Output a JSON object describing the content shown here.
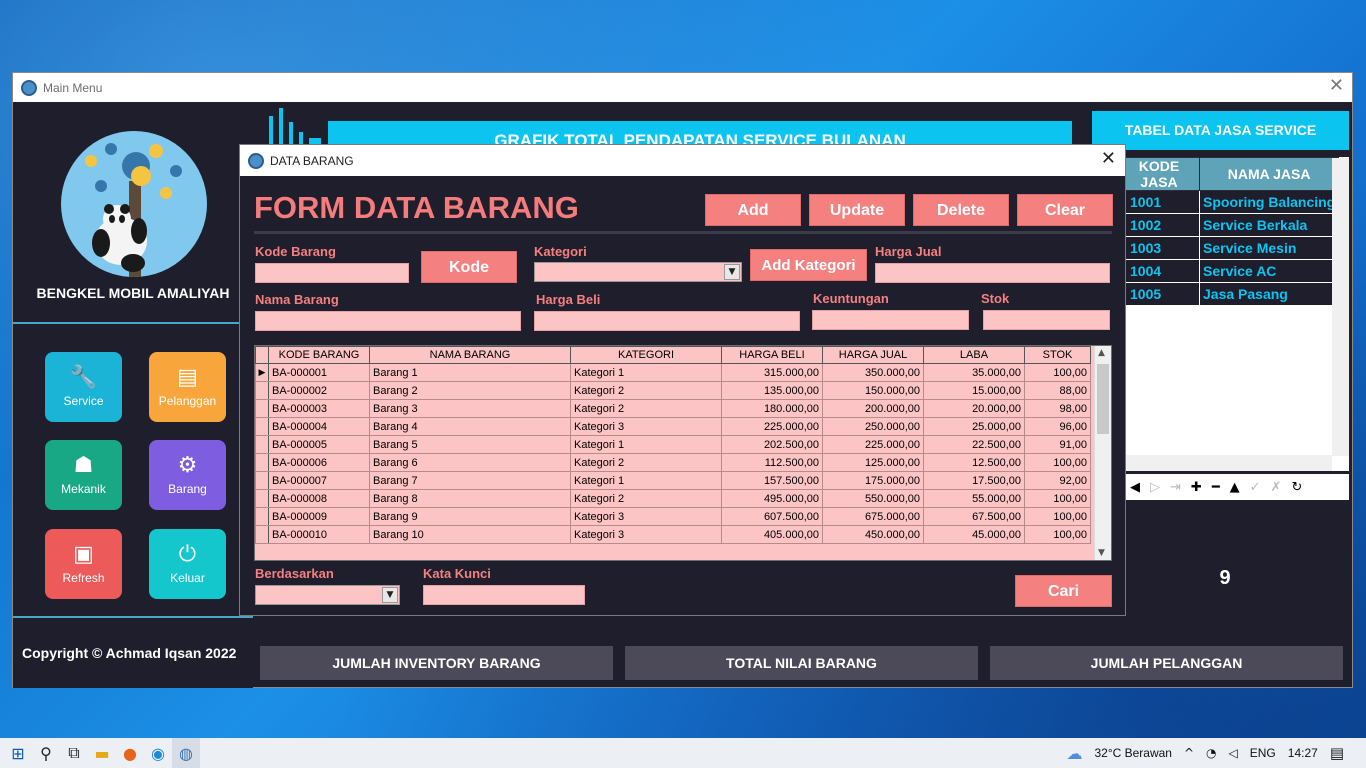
{
  "main_window": {
    "title": "Main Menu",
    "brand": "BENGKEL MOBIL AMALIYAH",
    "copyright": "Copyright © Achmad Iqsan 2022",
    "menu": [
      {
        "label": "Service",
        "icon": "wrench-icon",
        "color": "#1bb3d6"
      },
      {
        "label": "Pelanggan",
        "icon": "id-card-icon",
        "color": "#f8a63c"
      },
      {
        "label": "Mekanik",
        "icon": "mechanic-icon",
        "color": "#18a886"
      },
      {
        "label": "Barang",
        "icon": "gears-icon",
        "color": "#7e5de0"
      },
      {
        "label": "Refresh",
        "icon": "floppy-icon",
        "color": "#ec5a5a"
      },
      {
        "label": "Keluar",
        "icon": "power-icon",
        "color": "#14c7cc"
      }
    ],
    "chart_title": "GRAFIK TOTAL PENDAPATAN SERVICE BULANAN",
    "tabel_jasa_title": "TABEL DATA JASA SERVICE",
    "jasa_table": {
      "headers": [
        "KODE JASA",
        "NAMA JASA"
      ],
      "rows": [
        [
          "1001",
          "Spooring Balancing"
        ],
        [
          "1002",
          "Service Berkala"
        ],
        [
          "1003",
          "Service Mesin"
        ],
        [
          "1004",
          "Service AC"
        ],
        [
          "1005",
          "Jasa Pasang"
        ]
      ]
    },
    "stat_value": "9",
    "stats": [
      "JUMLAH INVENTORY BARANG",
      "TOTAL NILAI BARANG",
      "JUMLAH PELANGGAN"
    ]
  },
  "dialog": {
    "title": "DATA BARANG",
    "form_title": "FORM DATA BARANG",
    "buttons": {
      "add": "Add",
      "update": "Update",
      "delete": "Delete",
      "clear": "Clear",
      "kode": "Kode",
      "add_kategori": "Add Kategori",
      "cari": "Cari"
    },
    "labels": {
      "kode_barang": "Kode Barang",
      "kategori": "Kategori",
      "harga_jual": "Harga Jual",
      "nama_barang": "Nama Barang",
      "harga_beli": "Harga Beli",
      "keuntungan": "Keuntungan",
      "stok": "Stok",
      "berdasarkan": "Berdasarkan",
      "kata_kunci": "Kata Kunci"
    },
    "grid": {
      "headers": [
        "KODE BARANG",
        "NAMA BARANG",
        "KATEGORI",
        "HARGA BELI",
        "HARGA JUAL",
        "LABA",
        "STOK"
      ],
      "rows": [
        [
          "BA-000001",
          "Barang 1",
          "Kategori 1",
          "315.000,00",
          "350.000,00",
          "35.000,00",
          "100,00"
        ],
        [
          "BA-000002",
          "Barang 2",
          "Kategori 2",
          "135.000,00",
          "150.000,00",
          "15.000,00",
          "88,00"
        ],
        [
          "BA-000003",
          "Barang 3",
          "Kategori 2",
          "180.000,00",
          "200.000,00",
          "20.000,00",
          "98,00"
        ],
        [
          "BA-000004",
          "Barang 4",
          "Kategori 3",
          "225.000,00",
          "250.000,00",
          "25.000,00",
          "96,00"
        ],
        [
          "BA-000005",
          "Barang 5",
          "Kategori 1",
          "202.500,00",
          "225.000,00",
          "22.500,00",
          "91,00"
        ],
        [
          "BA-000006",
          "Barang 6",
          "Kategori 2",
          "112.500,00",
          "125.000,00",
          "12.500,00",
          "100,00"
        ],
        [
          "BA-000007",
          "Barang 7",
          "Kategori 1",
          "157.500,00",
          "175.000,00",
          "17.500,00",
          "92,00"
        ],
        [
          "BA-000008",
          "Barang 8",
          "Kategori 2",
          "495.000,00",
          "550.000,00",
          "55.000,00",
          "100,00"
        ],
        [
          "BA-000009",
          "Barang 9",
          "Kategori 3",
          "607.500,00",
          "675.000,00",
          "67.500,00",
          "100,00"
        ],
        [
          "BA-000010",
          "Barang 10",
          "Kategori 3",
          "405.000,00",
          "450.000,00",
          "45.000,00",
          "100,00"
        ]
      ]
    }
  },
  "taskbar": {
    "weather": "32°C  Berawan",
    "lang": "ENG",
    "time": "14:27"
  }
}
